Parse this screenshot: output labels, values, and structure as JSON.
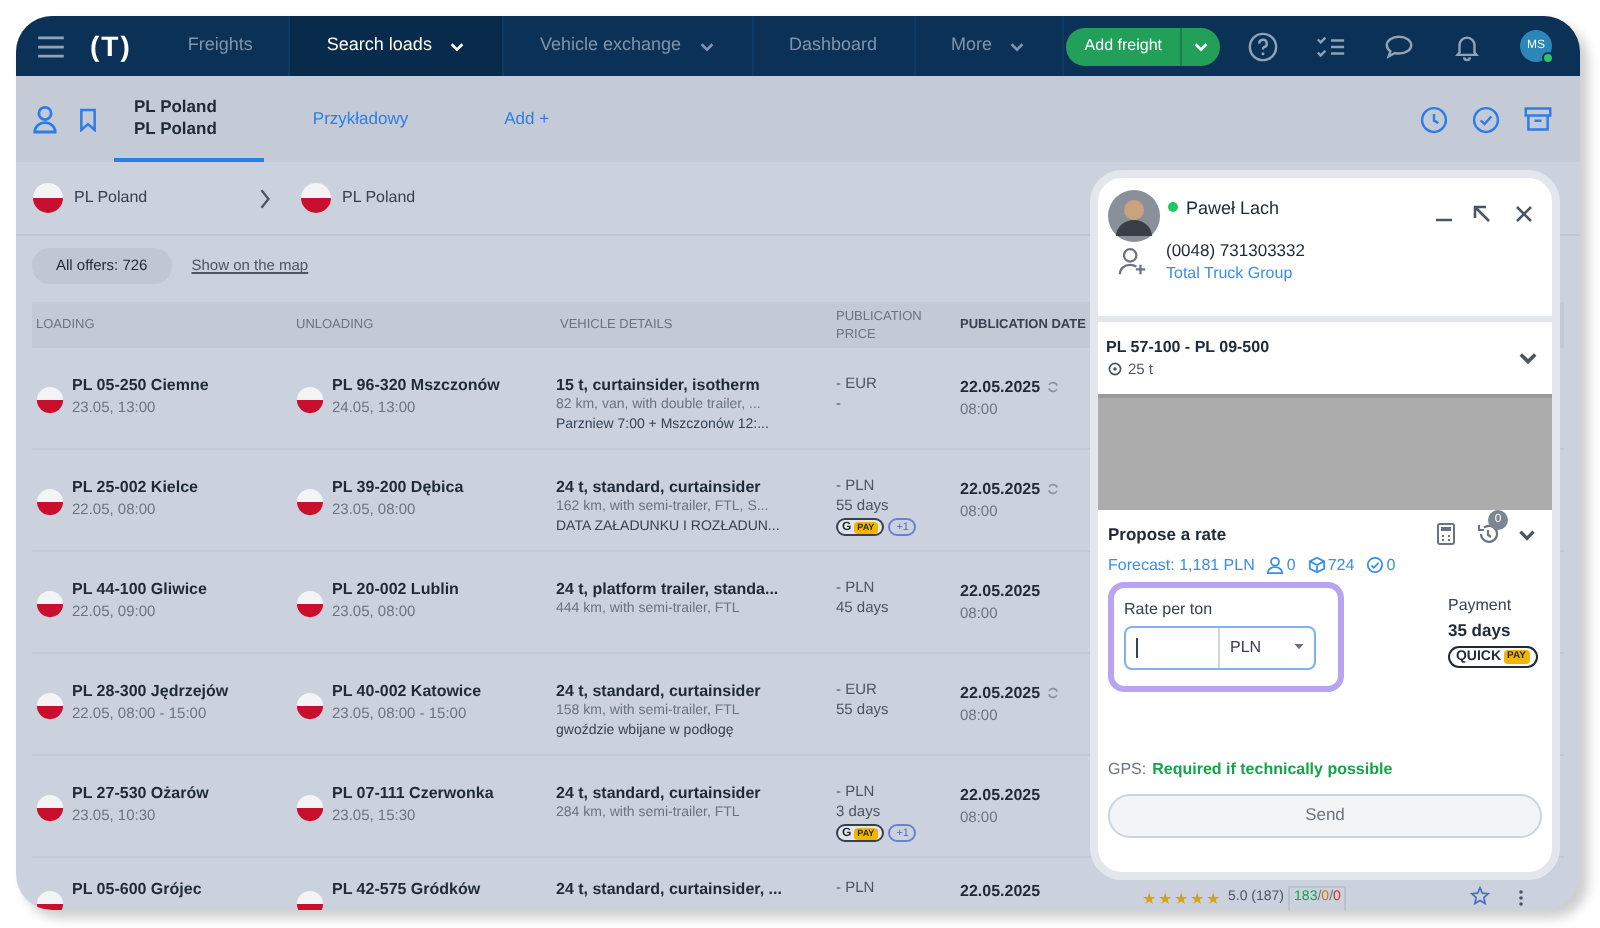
{
  "nav": {
    "logo": "(T)",
    "items": [
      {
        "label": "Freights",
        "selected": false,
        "dropdown": false
      },
      {
        "label": "Search loads",
        "selected": true,
        "dropdown": true
      },
      {
        "label": "Vehicle exchange",
        "selected": false,
        "dropdown": true
      },
      {
        "label": "Dashboard",
        "selected": false,
        "dropdown": false
      },
      {
        "label": "More",
        "selected": false,
        "dropdown": true
      }
    ],
    "add_button": "Add freight",
    "avatar": "MS",
    "avatar_online": true
  },
  "tabs": [
    {
      "label": "PL Poland\nPL Poland",
      "selected": true
    },
    {
      "label": "Przykładowy",
      "selected": false
    },
    {
      "label": "Add +",
      "selected": false
    }
  ],
  "route_filter": {
    "from": "PL Poland",
    "to": "PL Poland"
  },
  "offers": {
    "label": "All offers:",
    "count": "726",
    "map_link": "Show on the map"
  },
  "table": {
    "columns": [
      "LOADING",
      "UNLOADING",
      "VEHICLE DETAILS",
      "PUBLICATION\nPRICE",
      "PUBLICATION DATE"
    ],
    "rows": [
      {
        "loading": {
          "place": "PL 05-250 Ciemne",
          "time": "23.05, 13:00"
        },
        "unloading": {
          "place": "PL 96-320 Mszczonów",
          "time": "24.05, 13:00"
        },
        "vehicle": [
          "15 t, curtainsider, isotherm",
          "82 km, van, with double trailer, ...",
          "Parzniew 7:00 + Mszczonów 12:..."
        ],
        "price": [
          "- EUR",
          "-"
        ],
        "badges": [],
        "date": "22.05.2025",
        "time": "08:00",
        "refreshed": true
      },
      {
        "loading": {
          "place": "PL 25-002 Kielce",
          "time": "22.05, 08:00"
        },
        "unloading": {
          "place": "PL 39-200 Dębica",
          "time": "23.05, 08:00"
        },
        "vehicle": [
          "24 t, standard, curtainsider",
          "162 km, with semi-trailer, FTL, S...",
          "DATA ZAŁADUNKU I ROZŁADUN..."
        ],
        "price": [
          "- PLN",
          "55 days"
        ],
        "badges": [
          {
            "kind": "gpay",
            "parts": [
              "G",
              "PAY"
            ]
          },
          {
            "kind": "more",
            "parts": [
              "+1"
            ]
          }
        ],
        "date": "22.05.2025",
        "time": "08:00",
        "refreshed": true
      },
      {
        "loading": {
          "place": "PL 44-100 Gliwice",
          "time": "22.05, 09:00"
        },
        "unloading": {
          "place": "PL 20-002 Lublin",
          "time": "23.05, 08:00"
        },
        "vehicle": [
          "24 t, platform trailer, standa...",
          "444 km, with semi-trailer, FTL"
        ],
        "price": [
          "- PLN",
          "45 days"
        ],
        "badges": [],
        "date": "22.05.2025",
        "time": "08:00",
        "refreshed": false
      },
      {
        "loading": {
          "place": "PL 28-300 Jędrzejów",
          "time": "22.05, 08:00 - 15:00"
        },
        "unloading": {
          "place": "PL 40-002 Katowice",
          "time": "23.05, 08:00 - 15:00"
        },
        "vehicle": [
          "24 t, standard, curtainsider",
          "158 km, with semi-trailer, FTL",
          "gwoździe wbijane w podłogę"
        ],
        "price": [
          "- EUR",
          "55 days"
        ],
        "badges": [],
        "date": "22.05.2025",
        "time": "08:00",
        "refreshed": true
      },
      {
        "loading": {
          "place": "PL 27-530 Ożarów",
          "time": "23.05, 10:30"
        },
        "unloading": {
          "place": "PL 07-111 Czerwonka",
          "time": "23.05, 15:30"
        },
        "vehicle": [
          "24 t, standard, curtainsider",
          "284 km, with semi-trailer, FTL"
        ],
        "price": [
          "- PLN",
          "3 days"
        ],
        "badges": [
          {
            "kind": "gpay",
            "parts": [
              "G",
              "PAY"
            ]
          },
          {
            "kind": "more",
            "parts": [
              "+1"
            ]
          }
        ],
        "date": "22.05.2025",
        "time": "08:00",
        "refreshed": false
      },
      {
        "loading": {
          "place": "PL 05-600 Grójec"
        },
        "unloading": {
          "place": "PL 42-575 Gródków"
        },
        "vehicle": [
          "24 t, standard, curtainsider, ..."
        ],
        "price": [
          "- PLN"
        ],
        "badges": [],
        "date": "22.05.2025",
        "refreshed": false,
        "rating": {
          "stars": 5,
          "score": "5.0",
          "reviews": "(187)",
          "separator": "/",
          "counts": [
            {
              "text": "183",
              "color": "#16a34a"
            },
            {
              "text": "0",
              "color": "#d97706"
            },
            {
              "text": "0",
              "color": "#dc2626"
            }
          ]
        }
      }
    ]
  },
  "panel": {
    "contact": {
      "name": "Paweł Lach",
      "online": true,
      "phone": "(0048) 731303332",
      "company": "Total Truck Group"
    },
    "route": {
      "title": "PL 57-100 - PL 09-500",
      "weight": "25 t"
    },
    "propose": {
      "title": "Propose a rate",
      "history_count": "0",
      "forecast": "Forecast: 1,181 PLN",
      "stats": [
        {
          "kind": "person",
          "value": "0"
        },
        {
          "kind": "cube",
          "value": "724"
        },
        {
          "kind": "check",
          "value": "0"
        }
      ],
      "rate_label": "Rate per ton",
      "currency": "PLN",
      "payment_label": "Payment",
      "payment_value": "35 days",
      "payment_badge": [
        "QUICK",
        "PAY"
      ],
      "gps_label": "GPS:",
      "gps_value": "Required if technically possible",
      "send": "Send"
    }
  }
}
